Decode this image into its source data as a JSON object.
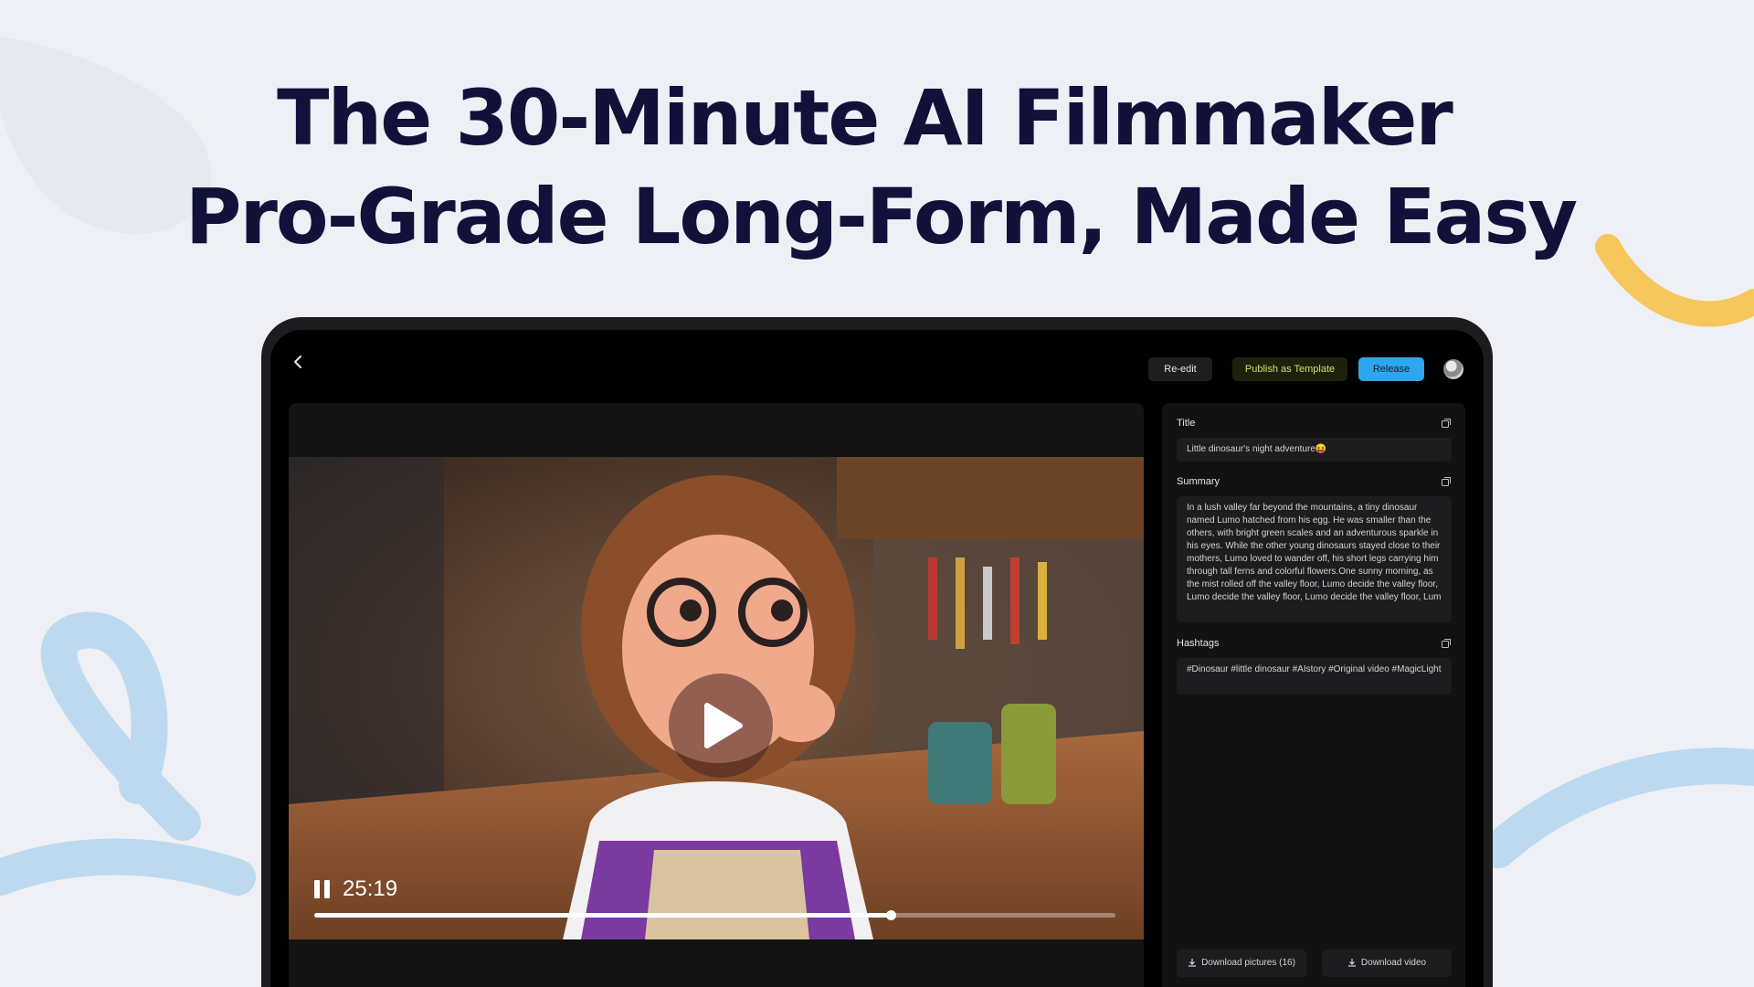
{
  "hero": {
    "line1": "The 30-Minute AI Filmmaker",
    "line2": "Pro-Grade Long-Form, Made Easy"
  },
  "topbar": {
    "back_icon": "chevron-left-icon",
    "reedit_label": "Re-edit",
    "publish_label": "Publish as Template",
    "release_label": "Release"
  },
  "player": {
    "time": "25:19",
    "progress": 0.72
  },
  "panel": {
    "title_label": "Title",
    "title_value": "Little dinosaur's night adventure😝",
    "summary_label": "Summary",
    "summary_value": "In a lush valley far beyond the mountains, a tiny dinosaur named Lumo hatched from his egg. He was smaller than the others, with bright green scales and an adventurous sparkle in his eyes. While the other young dinosaurs stayed close to their mothers, Lumo loved to wander off, his short legs carrying him through tall ferns and colorful flowers.One sunny morning, as the mist rolled off the valley floor, Lumo decide the valley floor, Lumo decide the valley floor, Lumo decide the valley floor, Lum",
    "hashtags_label": "Hashtags",
    "hashtags_value": "#Dinosaur #little dinosaur #AIstory #Original video #MagicLight",
    "download_pictures_label": "Download pictures (16)",
    "download_video_label": "Download video"
  },
  "colors": {
    "accent": "#2da6ee",
    "publish_text": "#cfe06a",
    "hero_text": "#11113a"
  }
}
